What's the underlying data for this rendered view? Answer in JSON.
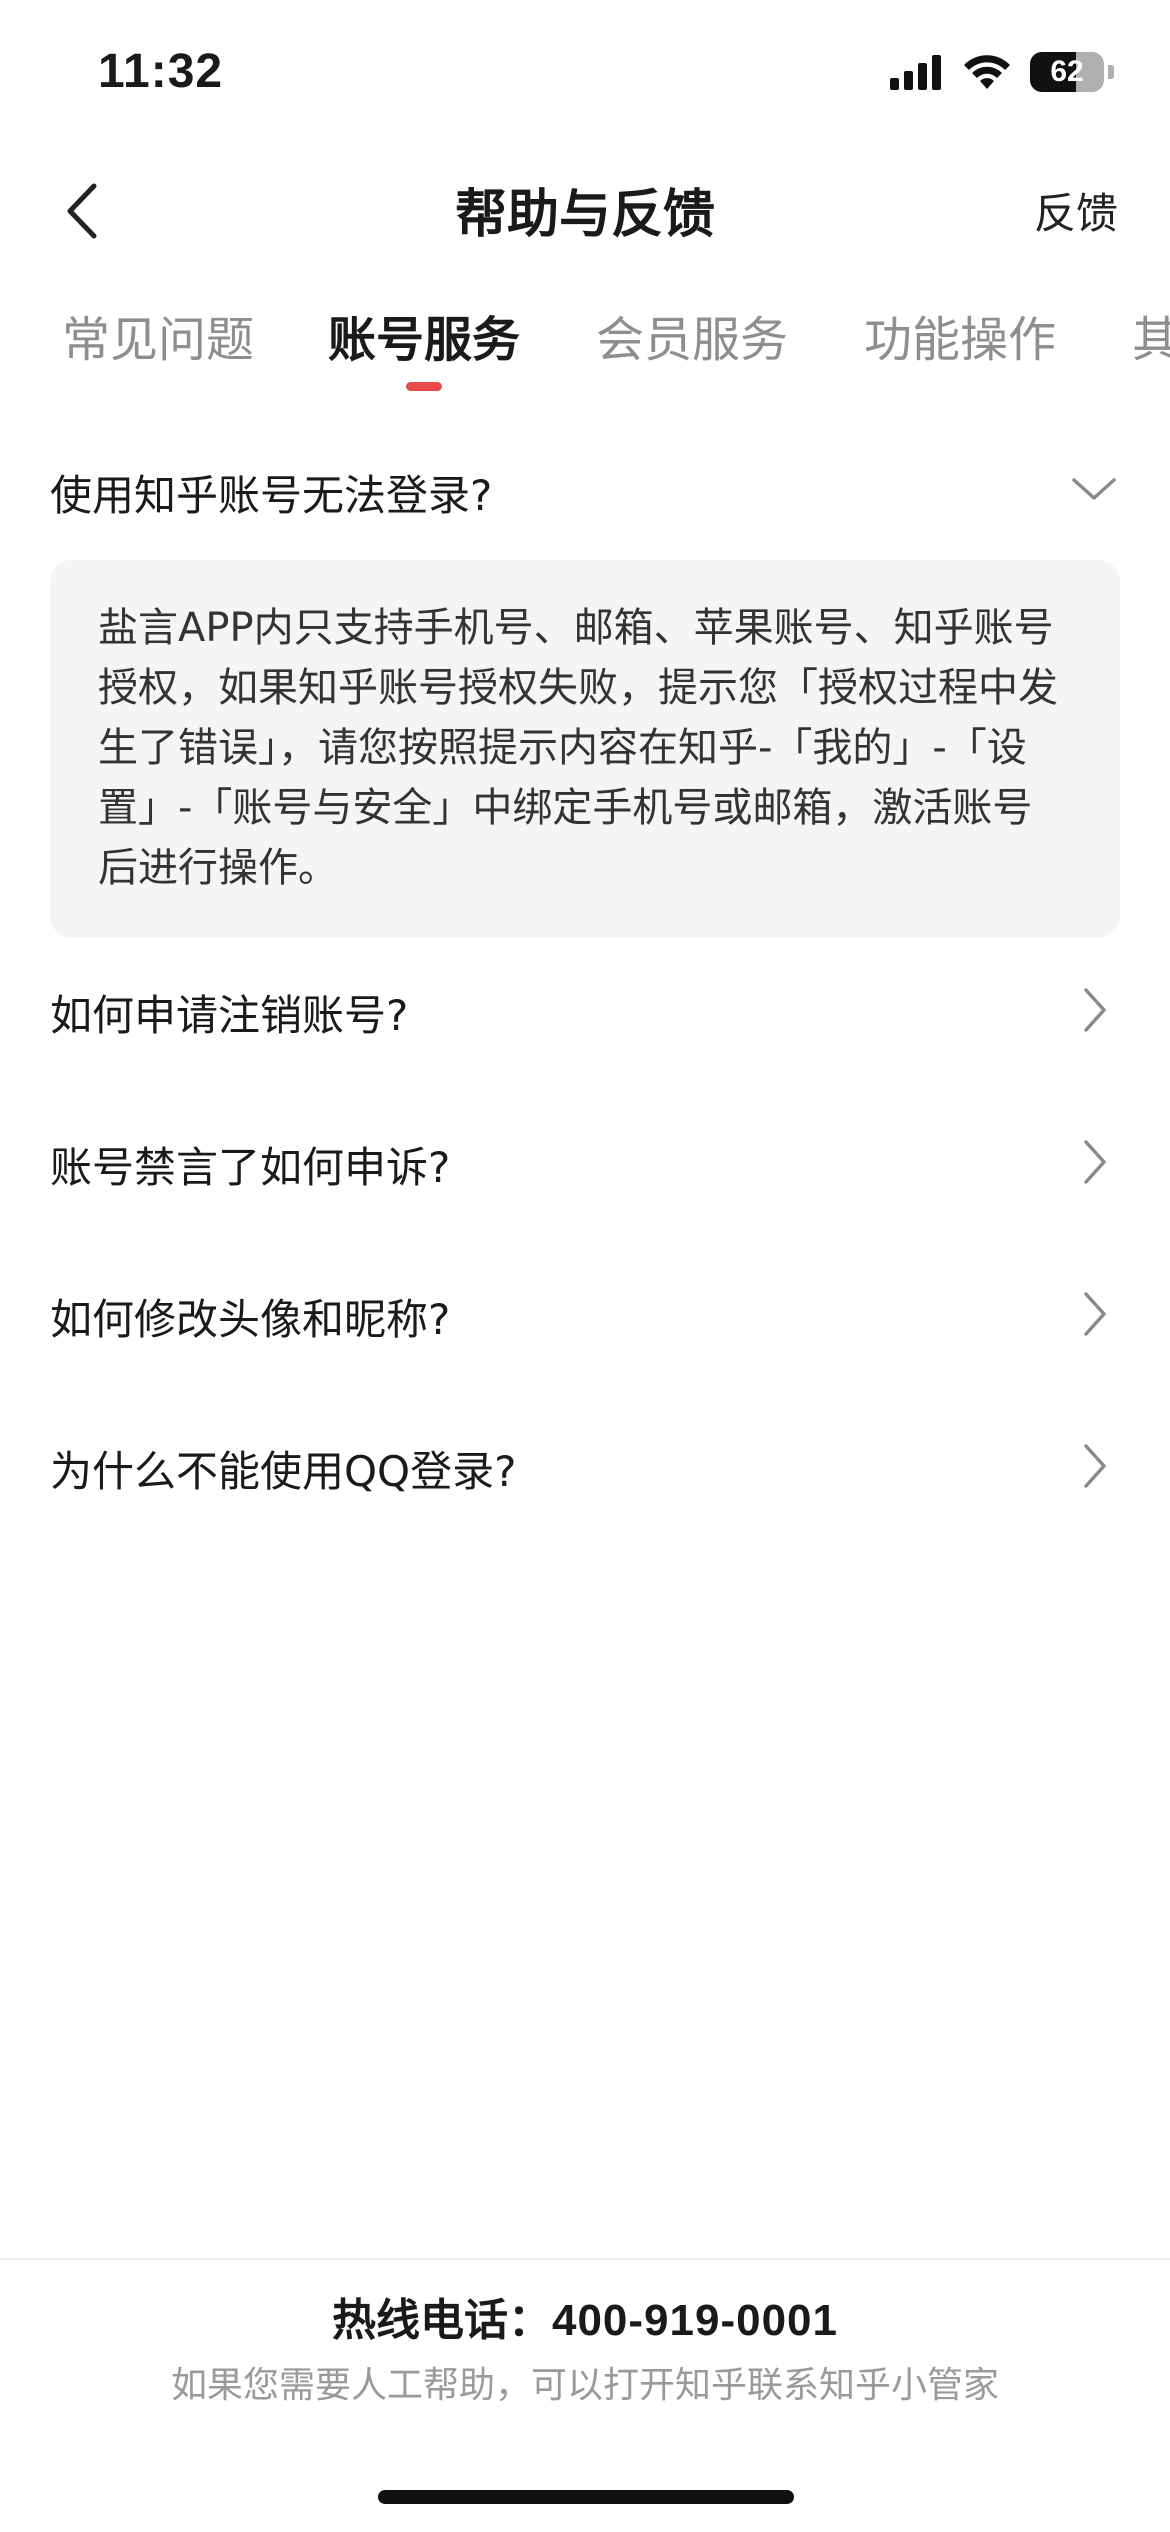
{
  "status_bar": {
    "time": "11:32",
    "battery_level": "62",
    "battery_percent": 0.62
  },
  "nav": {
    "title": "帮助与反馈",
    "feedback_label": "反馈"
  },
  "tabs": [
    {
      "label": "常见问题",
      "active": false
    },
    {
      "label": "账号服务",
      "active": true
    },
    {
      "label": "会员服务",
      "active": false
    },
    {
      "label": "功能操作",
      "active": false
    },
    {
      "label": "其",
      "active": false
    }
  ],
  "faq": {
    "expanded": {
      "question": "使用知乎账号无法登录?",
      "answer": "盐言APP内只支持手机号、邮箱、苹果账号、知乎账号授权，如果知乎账号授权失败，提示您「授权过程中发生了错误」，请您按照提示内容在知乎-「我的」-「设置」-「账号与安全」中绑定手机号或邮箱，激活账号后进行操作。"
    },
    "items": [
      {
        "question": "如何申请注销账号?"
      },
      {
        "question": "账号禁言了如何申诉?"
      },
      {
        "question": "如何修改头像和昵称?"
      },
      {
        "question": "为什么不能使用QQ登录?"
      }
    ]
  },
  "footer": {
    "hotline_label": "热线电话：",
    "hotline_number": "400-919-0001",
    "help_text": "如果您需要人工帮助，可以打开知乎联系知乎小管家"
  },
  "colors": {
    "accent": "#e84b4b",
    "answer_bg": "#f5f5f5",
    "muted_text": "#9a9a9a"
  }
}
